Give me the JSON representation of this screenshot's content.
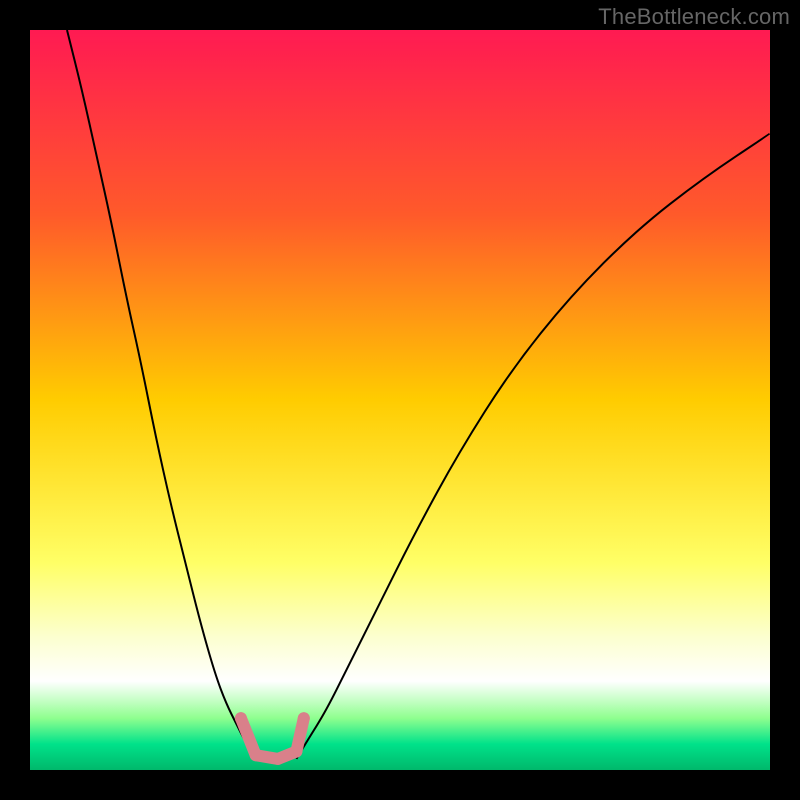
{
  "watermark": "TheBottleneck.com",
  "chart_data": {
    "type": "line",
    "title": "",
    "xlabel": "",
    "ylabel": "",
    "xlim": [
      0,
      100
    ],
    "ylim": [
      0,
      100
    ],
    "background_gradient": {
      "stops": [
        {
          "offset": 0.0,
          "color": "#ff1a52"
        },
        {
          "offset": 0.25,
          "color": "#ff5a2a"
        },
        {
          "offset": 0.5,
          "color": "#ffcc00"
        },
        {
          "offset": 0.72,
          "color": "#ffff66"
        },
        {
          "offset": 0.82,
          "color": "#fcffcf"
        },
        {
          "offset": 0.88,
          "color": "#ffffff"
        },
        {
          "offset": 0.93,
          "color": "#8fff8f"
        },
        {
          "offset": 0.965,
          "color": "#00e28a"
        },
        {
          "offset": 1.0,
          "color": "#00b86b"
        }
      ]
    },
    "series": [
      {
        "name": "curve-left",
        "stroke": "#000000",
        "stroke_width": 2,
        "x": [
          5,
          7,
          9,
          11,
          13,
          15,
          17,
          19,
          21,
          23,
          25,
          26.5,
          28,
          29,
          30,
          31
        ],
        "y": [
          100,
          92,
          83,
          74,
          64,
          55,
          45,
          36,
          28,
          20,
          13,
          9,
          6,
          4,
          2.5,
          1.5
        ]
      },
      {
        "name": "curve-right",
        "stroke": "#000000",
        "stroke_width": 2,
        "x": [
          36,
          37.5,
          40,
          43,
          47,
          52,
          58,
          65,
          73,
          82,
          91,
          100
        ],
        "y": [
          1.5,
          4,
          8,
          14,
          22,
          32,
          43,
          54,
          64,
          73,
          80,
          86
        ]
      },
      {
        "name": "dotted-valley",
        "stroke": "#d9808a",
        "stroke_width": 12,
        "linecap": "round",
        "linejoin": "round",
        "x": [
          28.5,
          30.5,
          33.5,
          36.0,
          37.0
        ],
        "y": [
          7.0,
          2.0,
          1.5,
          2.5,
          7.0
        ]
      }
    ],
    "annotations": []
  }
}
